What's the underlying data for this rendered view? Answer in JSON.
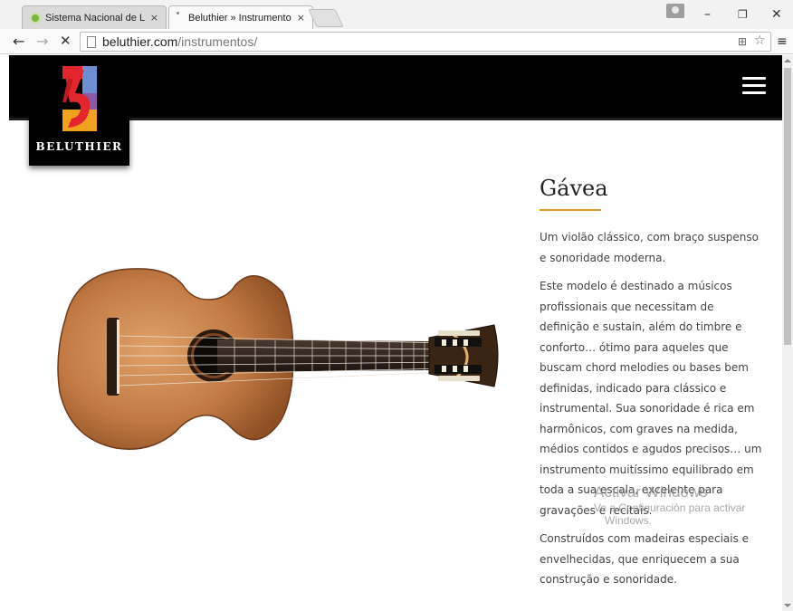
{
  "browser": {
    "tabs": [
      {
        "title": "Sistema Nacional de Luthe",
        "close": "×"
      },
      {
        "title": "Beluthier » Instrumentos",
        "close": "×"
      }
    ],
    "window_controls": {
      "minimize": "–",
      "maximize": "❐",
      "close": "✕"
    },
    "nav": {
      "back": "←",
      "forward": "→",
      "stop": "✕"
    },
    "url_domain": "beluthier.com",
    "url_path": "/instrumentos/",
    "menu": "≡"
  },
  "site": {
    "logo_text": "BELUTHIER"
  },
  "product": {
    "title": "Gávea",
    "paragraphs": [
      "Um violão clássico, com braço suspenso e sonoridade moderna.",
      "Este modelo é destinado a músicos profissionais que necessitam de definição e sustain, além do timbre e conforto… ótimo para aqueles que buscam chord melodies ou bases bem definidas, indicado para clássico e instrumental. Sua sonoridade é rica em harmônicos, com graves na medida, médios contidos e agudos precisos… um instrumento muitíssimo equilibrado em toda a sua escala, excelente para gravações e recitais.",
      "Construídos com madeiras especiais e envelhecidas, que enriquecem a sua construção e sonoridade."
    ]
  },
  "watermark": {
    "line1": "Activar Windows",
    "line2": "Ve a Configuración para activar",
    "line3": "Windows."
  },
  "colors": {
    "header": "#000000",
    "accent_rule": "#d39b2a",
    "text": "#444444"
  }
}
